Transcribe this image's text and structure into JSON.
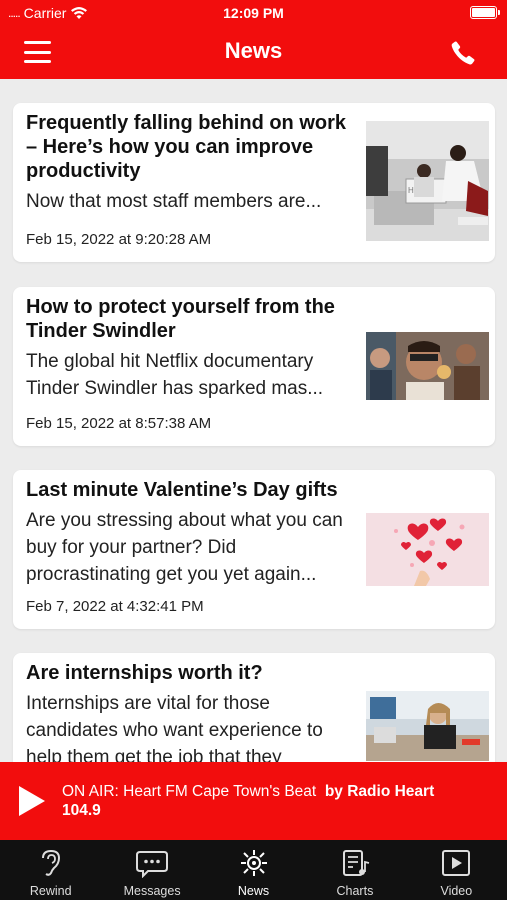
{
  "status_bar": {
    "carrier": "Carrier",
    "signal_dots": ".....",
    "time": "12:09 PM"
  },
  "nav": {
    "title": "News",
    "menu_icon": "hamburger-icon",
    "call_icon": "phone-icon"
  },
  "articles": [
    {
      "headline": "Frequently falling behind on work – Here’s how you can improve productivity",
      "summary": "Now that most staff members are...",
      "date": "Feb 15, 2022 at 9:20:28 AM"
    },
    {
      "headline": "How to protect yourself from the Tinder Swindler",
      "summary": "The global hit Netflix documentary Tinder Swindler has sparked mas...",
      "date": "Feb 15, 2022 at 8:57:38 AM"
    },
    {
      "headline": "Last minute Valentine’s Day gifts",
      "summary": "Are you stressing about what you can buy for your partner? Did procrastinating get you yet again...",
      "date": "Feb 7, 2022 at 4:32:41 PM"
    },
    {
      "headline": "Are internships worth it?",
      "summary": "Internships are vital for those candidates who want experience to help them get the job that they"
    }
  ],
  "player": {
    "on_air": "ON AIR: Heart FM Cape Town's Beat",
    "station": "by Radio Heart 104.9"
  },
  "tabs": [
    {
      "label": "Rewind",
      "icon": "ear-icon"
    },
    {
      "label": "Messages",
      "icon": "chat-bubble-icon"
    },
    {
      "label": "News",
      "icon": "news-satellite-icon"
    },
    {
      "label": "Charts",
      "icon": "charts-music-icon"
    },
    {
      "label": "Video",
      "icon": "video-play-icon"
    }
  ],
  "colors": {
    "brand_red": "#f20d0d",
    "tabbar_bg": "#111111",
    "feed_bg": "#ececec"
  }
}
